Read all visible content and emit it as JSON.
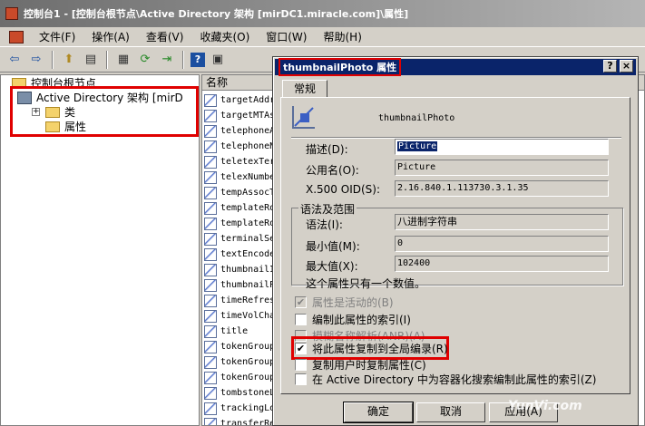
{
  "window": {
    "title": "控制台1 - [控制台根节点\\Active Directory 架构 [mirDC1.miracle.com]\\属性]"
  },
  "menu": [
    "文件(F)",
    "操作(A)",
    "查看(V)",
    "收藏夹(O)",
    "窗口(W)",
    "帮助(H)"
  ],
  "toolbar": {
    "icons": [
      "back-icon",
      "forward-icon",
      "up-icon",
      "show-tree-icon",
      "properties-icon",
      "refresh-icon",
      "export-icon",
      "help-icon",
      "console-icon"
    ]
  },
  "tree": {
    "root": "控制台根节点",
    "ad_node": "Active Directory 架构 [mirD",
    "classes": "类",
    "attributes": "属性"
  },
  "list": {
    "column_header": "名称",
    "rows": [
      "targetAddr",
      "targetMTAs",
      "telephoneA",
      "telephoneN",
      "teletexTer",
      "telexNumbe",
      "tempAssocT",
      "templateRo",
      "templateRo",
      "terminalSe",
      "textEncode",
      "thumbnailI",
      "thumbnailP",
      "timeRefres",
      "timeVolCha",
      "title",
      "tokenGroup",
      "tokenGroup",
      "tokenGroup",
      "tombstoneL",
      "trackingLo",
      "transferRe"
    ]
  },
  "dialog": {
    "title": "thumbnailPhoto 属性",
    "help_btn": "?",
    "close_btn": "×",
    "tab": "常规",
    "attr_name": "thumbnailPhoto",
    "description_label": "描述(D):",
    "description_value": "Picture",
    "common_name_label": "公用名(O):",
    "common_name_value": "Picture",
    "oid_label": "X.500 OID(S):",
    "oid_value": "2.16.840.1.113730.3.1.35",
    "syntax_group": "语法及范围",
    "syntax_label": "语法(I):",
    "syntax_value": "八进制字符串",
    "min_label": "最小值(M):",
    "min_value": "0",
    "max_label": "最大值(X):",
    "max_value": "102400",
    "single_value_note": "这个属性只有一个数值。",
    "checks": {
      "active": "属性是活动的(B)",
      "index": "编制此属性的索引(I)",
      "anr": "模糊名称解析(ANR)(A)",
      "replicate_gc": "将此属性复制到全局编录(R)",
      "copy_user": "复制用户时复制属性(C)",
      "container_index": "在 Active Directory 中为容器化搜索编制此属性的索引(Z)"
    },
    "buttons": {
      "ok": "确定",
      "cancel": "取消",
      "apply": "应用(A)"
    }
  },
  "watermark": "YunVi.com"
}
